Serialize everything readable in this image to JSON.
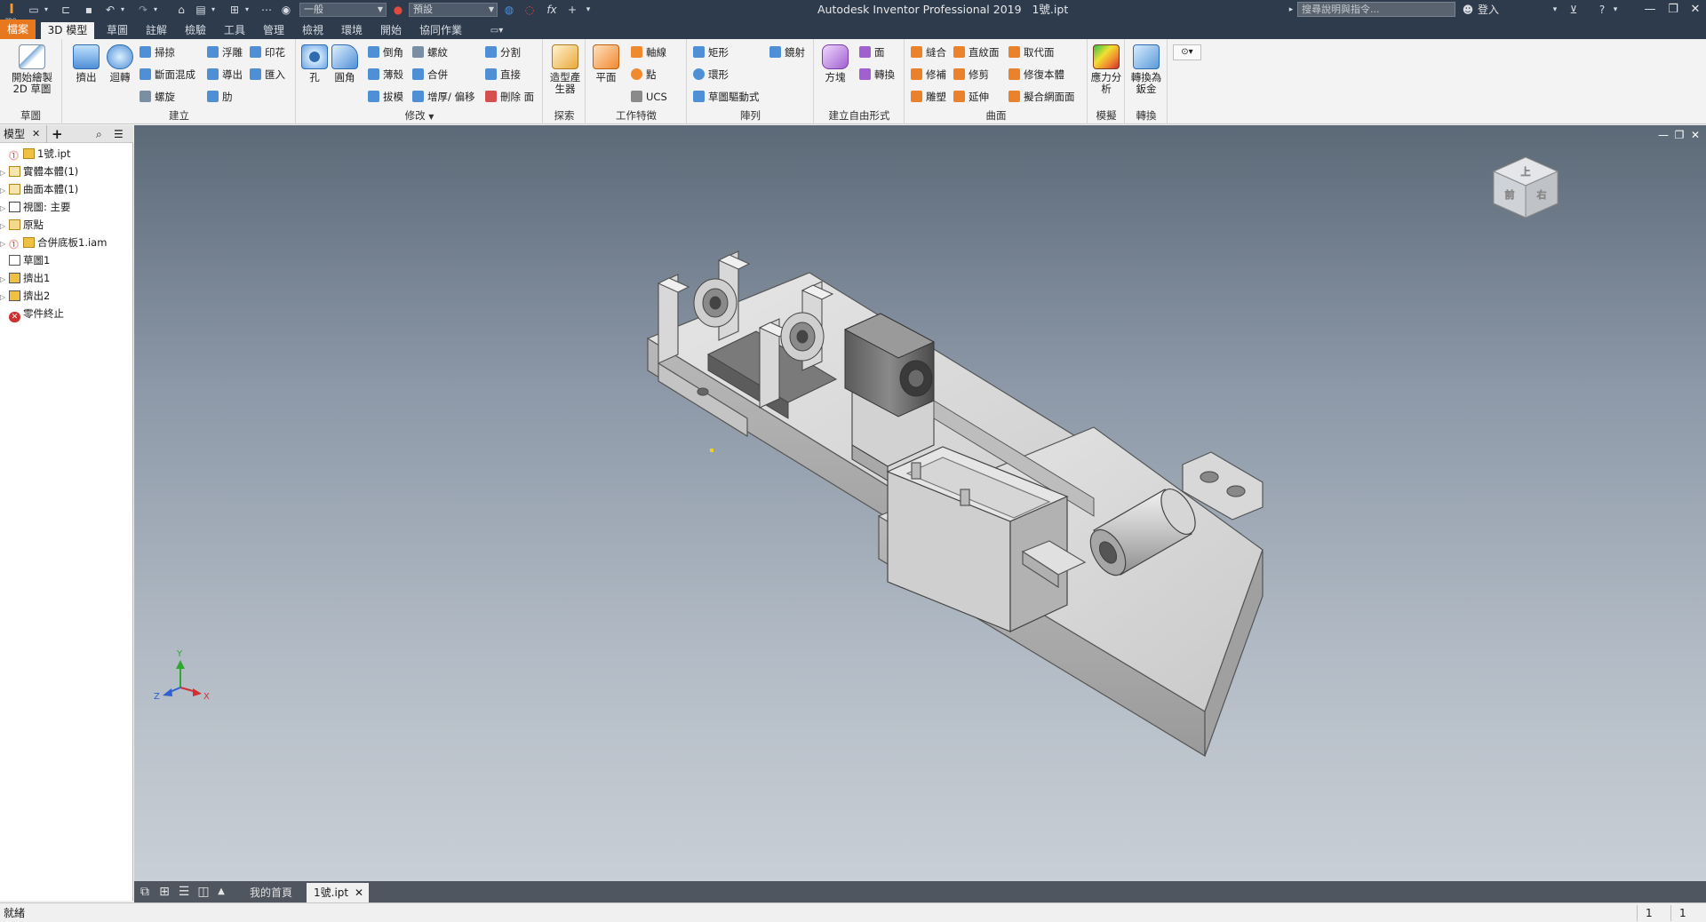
{
  "window": {
    "title": "Autodesk Inventor Professional 2019",
    "document": "1號.ipt",
    "logo": "I",
    "logo_sub": "PRO"
  },
  "quick_access": {
    "style_dropdown": "一般",
    "appearance_dropdown": "預設",
    "fx": "fx"
  },
  "help": {
    "search_placeholder": "搜尋說明與指令...",
    "signin": "登入"
  },
  "ribbon_tabs": [
    {
      "label": "檔案"
    },
    {
      "label": "3D 模型"
    },
    {
      "label": "草圖"
    },
    {
      "label": "註解"
    },
    {
      "label": "檢驗"
    },
    {
      "label": "工具"
    },
    {
      "label": "管理"
    },
    {
      "label": "檢視"
    },
    {
      "label": "環境"
    },
    {
      "label": "開始"
    },
    {
      "label": "協同作業"
    }
  ],
  "ribbon": {
    "sketch": {
      "label": "草圖",
      "start_2d_sketch": "開始繪製 2D 草圖"
    },
    "create": {
      "label": "建立",
      "extrude": "擠出",
      "revolve": "迴轉",
      "sweep": "掃掠",
      "loft": "斷面混成",
      "coil": "螺旋",
      "emboss": "浮雕",
      "derive": "導出",
      "rib": "肋",
      "decal": "印花",
      "import": "匯入"
    },
    "modify": {
      "label": "修改",
      "hole": "孔",
      "fillet": "圓角",
      "chamfer": "倒角",
      "shell": "薄殼",
      "draft": "拔模",
      "thread": "螺紋",
      "combine": "合併",
      "thicken": "增厚/ 偏移",
      "split": "分割",
      "direct": "直接",
      "delete_face": "刪除 面"
    },
    "explore": {
      "label": "探索",
      "shape_generator": "造型產生器"
    },
    "work_features": {
      "label": "工作特徵",
      "plane": "平面",
      "axis": "軸線",
      "point": "點",
      "ucs": "UCS"
    },
    "pattern": {
      "label": "陣列",
      "rectangular": "矩形",
      "circular": "環形",
      "sketch_driven": "草圖驅動式",
      "mirror": "鏡射"
    },
    "freeform": {
      "label": "建立自由形式",
      "box": "方塊",
      "face": "面",
      "convert": "轉換"
    },
    "surface": {
      "label": "曲面",
      "stitch": "縫合",
      "patch": "修補",
      "sculpt": "雕塑",
      "ruled": "直紋面",
      "trim": "修剪",
      "extend": "延伸",
      "replace_face": "取代面",
      "repair_bodies": "修復本體",
      "fit_mesh": "擬合網面面"
    },
    "simulation": {
      "label": "模擬",
      "stress_analysis": "應力分析"
    },
    "convert": {
      "label": "轉換",
      "to_sheet_metal": "轉換為鈑金"
    }
  },
  "browser": {
    "tab_model": "模型",
    "tree": [
      {
        "label": "1號.ipt",
        "icon": "part-icon",
        "status": "warning"
      },
      {
        "label": "實體本體(1)",
        "icon": "solid-bodies-icon"
      },
      {
        "label": "曲面本體(1)",
        "icon": "surface-bodies-icon"
      },
      {
        "label": "視圖: 主要",
        "icon": "view-icon"
      },
      {
        "label": "原點",
        "icon": "folder-icon"
      },
      {
        "label": "合併底板1.iam",
        "icon": "assembly-icon",
        "status": "warning"
      },
      {
        "label": "草圖1",
        "icon": "sketch-icon"
      },
      {
        "label": "擠出1",
        "icon": "extrude-icon"
      },
      {
        "label": "擠出2",
        "icon": "extrude-icon"
      },
      {
        "label": "零件終止",
        "icon": "end-of-part-icon",
        "status": "error"
      }
    ]
  },
  "viewcube": {
    "top": "上",
    "front": "前",
    "right": "右"
  },
  "triad": {
    "x": "X",
    "y": "Y",
    "z": "Z"
  },
  "doc_tabs": [
    {
      "label": "我的首頁"
    },
    {
      "label": "1號.ipt"
    }
  ],
  "status": {
    "text": "就緒",
    "count1": "1",
    "count2": "1"
  }
}
